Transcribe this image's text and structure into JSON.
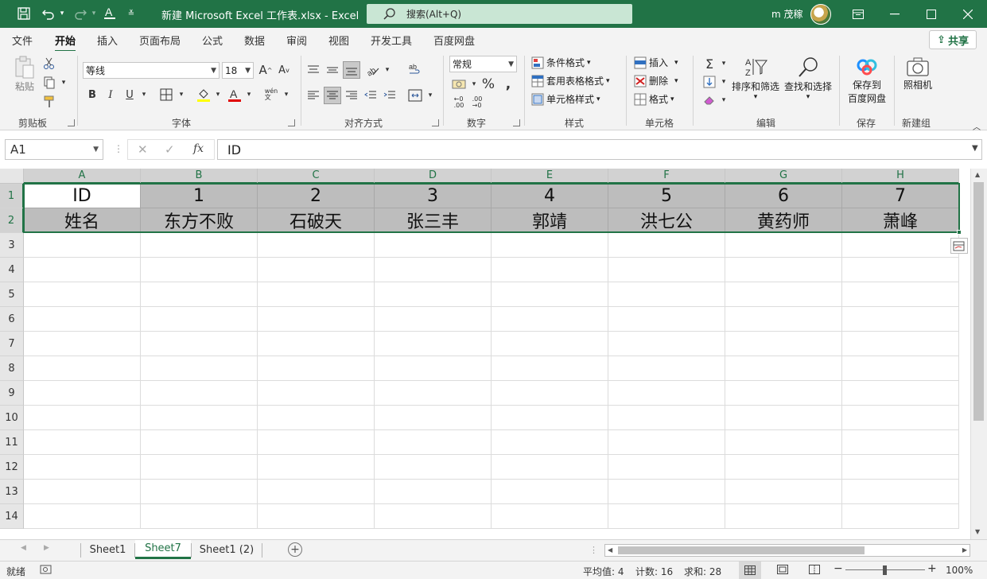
{
  "window": {
    "title": "新建 Microsoft Excel 工作表.xlsx  -  Excel",
    "search_placeholder": "搜索(Alt+Q)",
    "user_name": "m 茂稼"
  },
  "ribbon_tabs": [
    "文件",
    "开始",
    "插入",
    "页面布局",
    "公式",
    "数据",
    "审阅",
    "视图",
    "开发工具",
    "百度网盘"
  ],
  "active_tab": "开始",
  "share_label": "共享",
  "ribbon": {
    "clipboard": {
      "paste": "粘贴",
      "group": "剪贴板"
    },
    "font": {
      "name": "等线",
      "size": "18",
      "group": "字体"
    },
    "alignment": {
      "group": "对齐方式"
    },
    "number": {
      "format": "常规",
      "group": "数字"
    },
    "styles": {
      "conditional": "条件格式",
      "table": "套用表格格式",
      "cell": "单元格样式",
      "group": "样式"
    },
    "cells": {
      "insert": "插入",
      "delete": "删除",
      "format": "格式",
      "group": "单元格"
    },
    "editing": {
      "sort": "排序和筛选",
      "find": "查找和选择",
      "group": "编辑"
    },
    "save": {
      "label1": "保存到",
      "label2": "百度网盘",
      "group": "保存"
    },
    "newgroup": {
      "camera": "照相机",
      "group": "新建组"
    }
  },
  "formula_bar": {
    "name_box": "A1",
    "value": "ID"
  },
  "columns": [
    "A",
    "B",
    "C",
    "D",
    "E",
    "F",
    "G",
    "H"
  ],
  "rows": [
    "1",
    "2",
    "3",
    "4",
    "5",
    "6",
    "7",
    "8",
    "9",
    "10",
    "11",
    "12",
    "13",
    "14"
  ],
  "cells": {
    "row1": [
      "ID",
      "1",
      "2",
      "3",
      "4",
      "5",
      "6",
      "7"
    ],
    "row2": [
      "姓名",
      "东方不败",
      "石破天",
      "张三丰",
      "郭靖",
      "洪七公",
      "黄药师",
      "萧峰"
    ]
  },
  "sheets": [
    "Sheet1",
    "Sheet7",
    "Sheet1 (2)"
  ],
  "active_sheet": "Sheet7",
  "status": {
    "mode": "就绪",
    "average": "平均值: 4",
    "count": "计数: 16",
    "sum": "求和: 28",
    "zoom": "100%"
  },
  "colors": {
    "accent": "#217346",
    "selection_fill": "#bdbdbd"
  }
}
